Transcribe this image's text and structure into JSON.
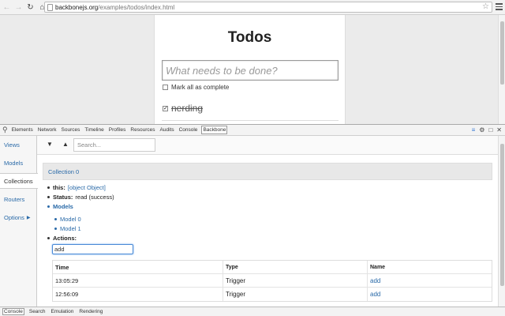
{
  "browser": {
    "url_host": "backbonejs.org",
    "url_path": "/examples/todos/index.html",
    "back_icon": "back-arrow-icon",
    "forward_icon": "forward-arrow-icon",
    "reload_icon": "reload-icon",
    "home_icon": "home-icon"
  },
  "page": {
    "title": "Todos",
    "new_todo_placeholder": "What needs to be done?",
    "mark_all_label": "Mark all as complete",
    "todos": [
      {
        "text": "nerding",
        "completed": true
      }
    ]
  },
  "devtools": {
    "tabs": [
      "Elements",
      "Network",
      "Sources",
      "Timeline",
      "Profiles",
      "Resources",
      "Audits",
      "Console",
      "Backbone"
    ],
    "active_tab": "Backbone",
    "sidebar": [
      {
        "label": "Views"
      },
      {
        "label": "Models"
      },
      {
        "label": "Collections"
      },
      {
        "label": "Routers"
      },
      {
        "label": "Options"
      }
    ],
    "active_sidebar": "Collections",
    "search_placeholder": "Search...",
    "collection_title": "Collection 0",
    "this_label": "this:",
    "this_value": "[object Object]",
    "status_label": "Status:",
    "status_value": "read (success)",
    "models_label": "Models",
    "models": [
      "Model 0",
      "Model 1"
    ],
    "actions_label": "Actions:",
    "action_filter_value": "add",
    "table": {
      "headers": [
        "Time",
        "Type",
        "Name"
      ],
      "rows": [
        [
          "13:05:29",
          "Trigger",
          "add"
        ],
        [
          "12:56:09",
          "Trigger",
          "add"
        ]
      ]
    },
    "drawer_tabs": [
      "Console",
      "Search",
      "Emulation",
      "Rendering"
    ],
    "active_drawer_tab": "Console"
  }
}
